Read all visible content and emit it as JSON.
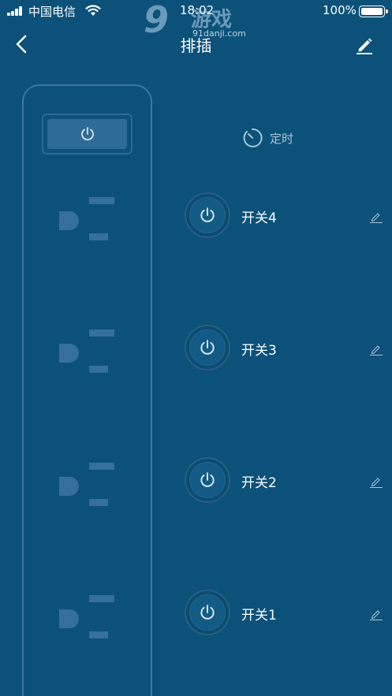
{
  "status_bar": {
    "carrier": "中国电信",
    "time": "18:02",
    "battery_percent": "100%"
  },
  "watermark": {
    "number": "9",
    "chinese": "游戏",
    "url": "91danji.com"
  },
  "nav": {
    "title": "排插",
    "back_icon": "chevron-left-icon",
    "edit_icon": "pencil-icon"
  },
  "timer": {
    "label": "定时",
    "icon": "timer-icon"
  },
  "switches": [
    {
      "label": "开关4",
      "icon": "power-icon",
      "edit_icon": "pencil-icon"
    },
    {
      "label": "开关3",
      "icon": "power-icon",
      "edit_icon": "pencil-icon"
    },
    {
      "label": "开关2",
      "icon": "power-icon",
      "edit_icon": "pencil-icon"
    },
    {
      "label": "开关1",
      "icon": "power-icon",
      "edit_icon": "pencil-icon"
    }
  ],
  "colors": {
    "background": "#0b5179",
    "strip_border": "#3e76a0",
    "socket": "#356f9a",
    "muted_text": "#a9c4da"
  }
}
